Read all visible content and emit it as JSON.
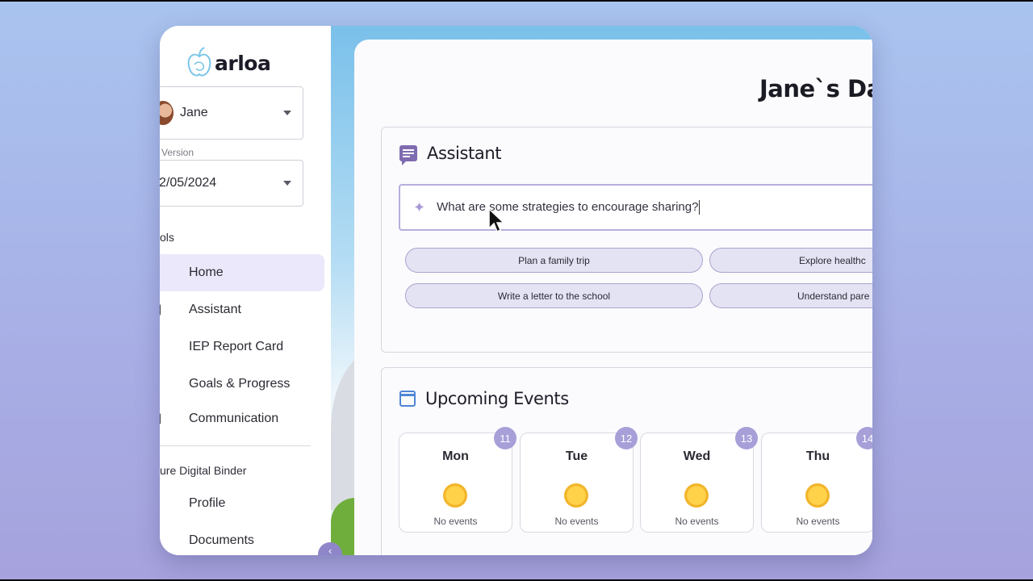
{
  "app": {
    "name": "arloa"
  },
  "sidebar": {
    "user": {
      "name": "Jane"
    },
    "version": {
      "label": "Version",
      "value": "2/05/2024"
    },
    "tools_label": "ols",
    "items": [
      {
        "label": "Home",
        "active": true
      },
      {
        "label": "Assistant",
        "active": false
      },
      {
        "label": "IEP Report Card",
        "active": false
      },
      {
        "label": "Goals & Progress",
        "active": false
      },
      {
        "label": "Communication",
        "active": false
      }
    ],
    "binder_label": "ure Digital Binder",
    "binder_items": [
      {
        "label": "Profile"
      },
      {
        "label": "Documents"
      }
    ],
    "collapse_glyph": "‹"
  },
  "main": {
    "title": "Jane`s Das",
    "assistant": {
      "title": "Assistant",
      "prompt": "What are some strategies to encourage sharing?",
      "suggestions": [
        "Plan a family trip",
        "Explore healthc",
        "Write a letter to the school",
        "Understand pare"
      ]
    },
    "events": {
      "title": "Upcoming Events",
      "days": [
        {
          "name": "Mon",
          "date": "11",
          "status": "No events"
        },
        {
          "name": "Tue",
          "date": "12",
          "status": "No events"
        },
        {
          "name": "Wed",
          "date": "13",
          "status": "No events"
        },
        {
          "name": "Thu",
          "date": "14",
          "status": "No events"
        }
      ]
    }
  },
  "colors": {
    "accent": "#8f86c9",
    "active_nav_bg": "#ece8fb",
    "chip_bg": "#e4e3f3",
    "badge": "#a69fd8"
  }
}
